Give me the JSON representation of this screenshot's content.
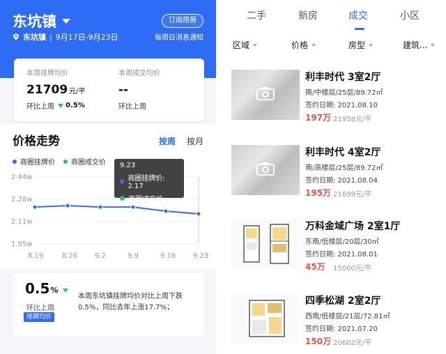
{
  "header": {
    "town": "东坑镇",
    "location": "东坑镇",
    "date_range": "9月17日-9月23日",
    "subscribe_label": "订阅周报",
    "subscribe_note": "每周日消息通知"
  },
  "stats": {
    "listing": {
      "label": "本周挂牌均价",
      "value": "21709",
      "unit": "元/平",
      "change_label": "环比上周",
      "change": "0.5%"
    },
    "deal": {
      "label": "本周成交均价",
      "value": "--",
      "change_label": "环比上周"
    }
  },
  "trend": {
    "title": "价格走势",
    "tabs": [
      "按周",
      "按月"
    ],
    "active_tab": "按周",
    "colors": {
      "listing": "#2e6cf6",
      "deal": "#2eb88a"
    }
  },
  "tooltip": {
    "date": "9.23",
    "listing_label": "商圈挂牌价: 2.17",
    "deal_label": "商圈成交价:"
  },
  "chart_data": {
    "type": "line",
    "x": [
      "8.19",
      "8.26",
      "9.2",
      "9.9",
      "9.16",
      "9.23"
    ],
    "series": [
      {
        "name": "商圈挂牌价",
        "values": [
          2.22,
          2.23,
          2.22,
          2.22,
          2.19,
          2.17
        ]
      }
    ],
    "legend": [
      "商圈挂牌价",
      "商圈成交价"
    ],
    "y_ticks": [
      "2.44w",
      "2.28w",
      "2.11w",
      "1.95w"
    ],
    "ylim": [
      1.95,
      2.44
    ],
    "grid": true
  },
  "summary": {
    "pct": "0.5",
    "pct_sign": "%",
    "sub": "环比上周",
    "badge": "挂牌均价",
    "text": "本周东坑镇挂牌均价对比上周下跌0.5%，同比去年上涨17.7%；"
  },
  "tabs": [
    "二手",
    "新房",
    "成交",
    "小区"
  ],
  "active_tab": "成交",
  "filters": [
    "区域",
    "价格",
    "房型",
    "建筑..."
  ],
  "listings": [
    {
      "title": "利丰时代 3室2厅",
      "desc": "南/中楼层/25层/89.72㎡",
      "date": "签约日期: 2021.08.10",
      "price": "197万",
      "unit_price": "21958元/平",
      "thumb": "photo"
    },
    {
      "title": "利丰时代 4室2厅",
      "desc": "南/高楼层/25层/89.72㎡",
      "date": "签约日期: 2021.08.04",
      "price": "195万",
      "unit_price": "21699元/平",
      "thumb": "photo"
    },
    {
      "title": "万科金域广场 2室1厅",
      "desc": "东南/低楼层/20层/30㎡",
      "date": "签约日期: 2021.08.01",
      "price": "45万",
      "unit_price": "15000元/平",
      "thumb": "floorplan"
    },
    {
      "title": "四季松湖 2室2厅",
      "desc": "西南/低楼层/21层/72.81㎡",
      "date": "签约日期: 2021.07.20",
      "price": "150万",
      "unit_price": "20602元/平",
      "thumb": "floorplan"
    }
  ]
}
